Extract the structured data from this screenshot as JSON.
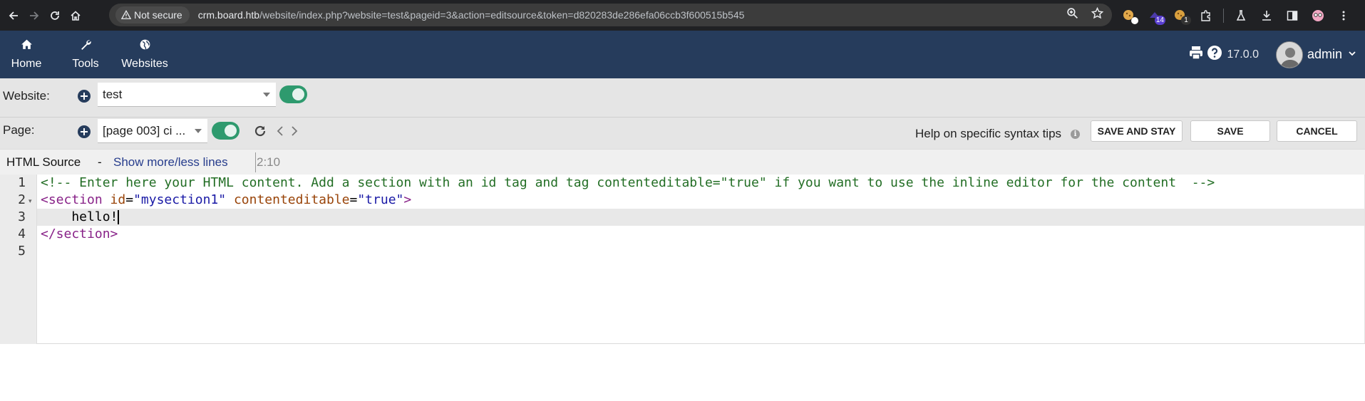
{
  "browser": {
    "security_label": "Not secure",
    "url_host": "crm.board.htb",
    "url_path": "/website/index.php?website=test&pageid=3&action=editsource&token=d820283de286efa06ccb3f600515b545",
    "ext_badge_1": "14",
    "ext_badge_2": "1"
  },
  "topbar": {
    "menu": [
      {
        "label": "Home",
        "icon": "home-icon"
      },
      {
        "label": "Tools",
        "icon": "wrench-icon"
      },
      {
        "label": "Websites",
        "icon": "globe-icon"
      }
    ],
    "version": "17.0.0",
    "user": "admin"
  },
  "website_row": {
    "label": "Website:",
    "selected": "test"
  },
  "page_row": {
    "label": "Page:",
    "selected": "[page 003] ci ..."
  },
  "actions": {
    "help_text": "Help on specific syntax tips",
    "info_glyph": "i",
    "save_and_stay": "SAVE AND STAY",
    "save": "SAVE",
    "cancel": "CANCEL"
  },
  "source": {
    "title": "HTML Source",
    "dash": "-",
    "toggle_link": "Show more/less lines",
    "cursor_pos": "2:10"
  },
  "editor": {
    "line_numbers": [
      "1",
      "2",
      "3",
      "4",
      "5"
    ],
    "line1_comment": "<!-- Enter here your HTML content. Add a section with an id tag and tag contenteditable=\"true\" if you want to use the inline editor for the content  -->",
    "line2": {
      "open": "<section",
      "attr1": " id",
      "eq1": "=",
      "val1": "\"mysection1\"",
      "attr2": " contenteditable",
      "eq2": "=",
      "val2": "\"true\"",
      "close": ">"
    },
    "line3_text": "    hello!",
    "line4_tag": "</section>"
  },
  "colors": {
    "topbar": "#263c5c",
    "toggle_on": "#2e9a6e",
    "comment": "#236e25",
    "tag": "#882288",
    "attribute": "#994409",
    "string": "#1a1aa6"
  }
}
